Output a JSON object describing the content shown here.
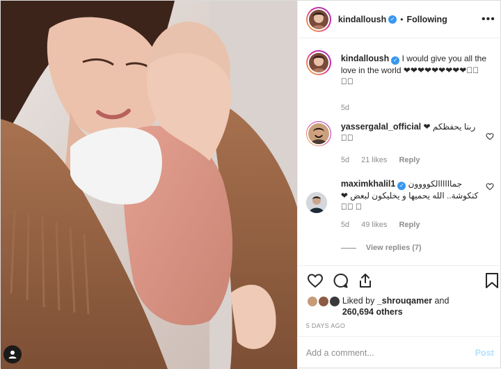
{
  "post": {
    "author": {
      "username": "kindalloush",
      "verified": true
    },
    "follow_status": "Following",
    "more_icon": "ellipsis-icon",
    "image": {
      "description_icon": "user-tag-icon"
    }
  },
  "caption": {
    "username": "kindalloush",
    "text": "I would give you all the love in the world ❤❤❤❤❤❤❤❤❤􀀀􀀀 􀀀􀀀",
    "time": "5d"
  },
  "comments": [
    {
      "username": "yassergalal_official",
      "verified": false,
      "text": "ربنا يحفظكم ❤ 􀀀􀀀",
      "time": "5d",
      "likes": "21 likes",
      "reply_label": "Reply"
    },
    {
      "username": "maximkhalil1",
      "verified": true,
      "text": "جماااااالكوووون كنكوشة.. الله يحميها و يخليكون لبعض ❤􀀀􀀀 􀀀",
      "time": "5d",
      "likes": "49 likes",
      "reply_label": "Reply",
      "view_replies": "View replies (7)"
    }
  ],
  "actions": {
    "like_icon": "heart-icon",
    "comment_icon": "comment-bubble-icon",
    "share_icon": "share-icon",
    "save_icon": "bookmark-icon"
  },
  "likes_summary": {
    "liked_by_prefix": "Liked by",
    "liked_by_user": "_shrouqamer",
    "and": "and",
    "others_count": "260,694 others"
  },
  "timestamp": "5 DAYS AGO",
  "add_comment": {
    "placeholder": "Add a comment...",
    "post_label": "Post"
  },
  "colors": {
    "link_blue": "#3897f0",
    "post_disabled": "#b2dffc",
    "muted": "#8e8e8e",
    "text": "#262626"
  }
}
